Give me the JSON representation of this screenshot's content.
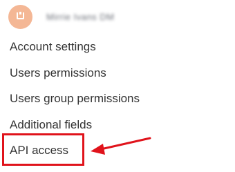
{
  "profile": {
    "avatar_icon": "user-avatar-icon",
    "name": "Mirrie Ivans DM"
  },
  "menu": {
    "items": [
      {
        "label": "Account settings"
      },
      {
        "label": "Users permissions"
      },
      {
        "label": "Users group permissions"
      },
      {
        "label": "Additional fields"
      },
      {
        "label": "API access"
      }
    ]
  },
  "annotation": {
    "highlighted_item": "API access",
    "arrow_icon": "red-arrow-icon"
  },
  "colors": {
    "avatar": "#f4b795",
    "text": "#333333",
    "annotation": "#e0131b"
  }
}
